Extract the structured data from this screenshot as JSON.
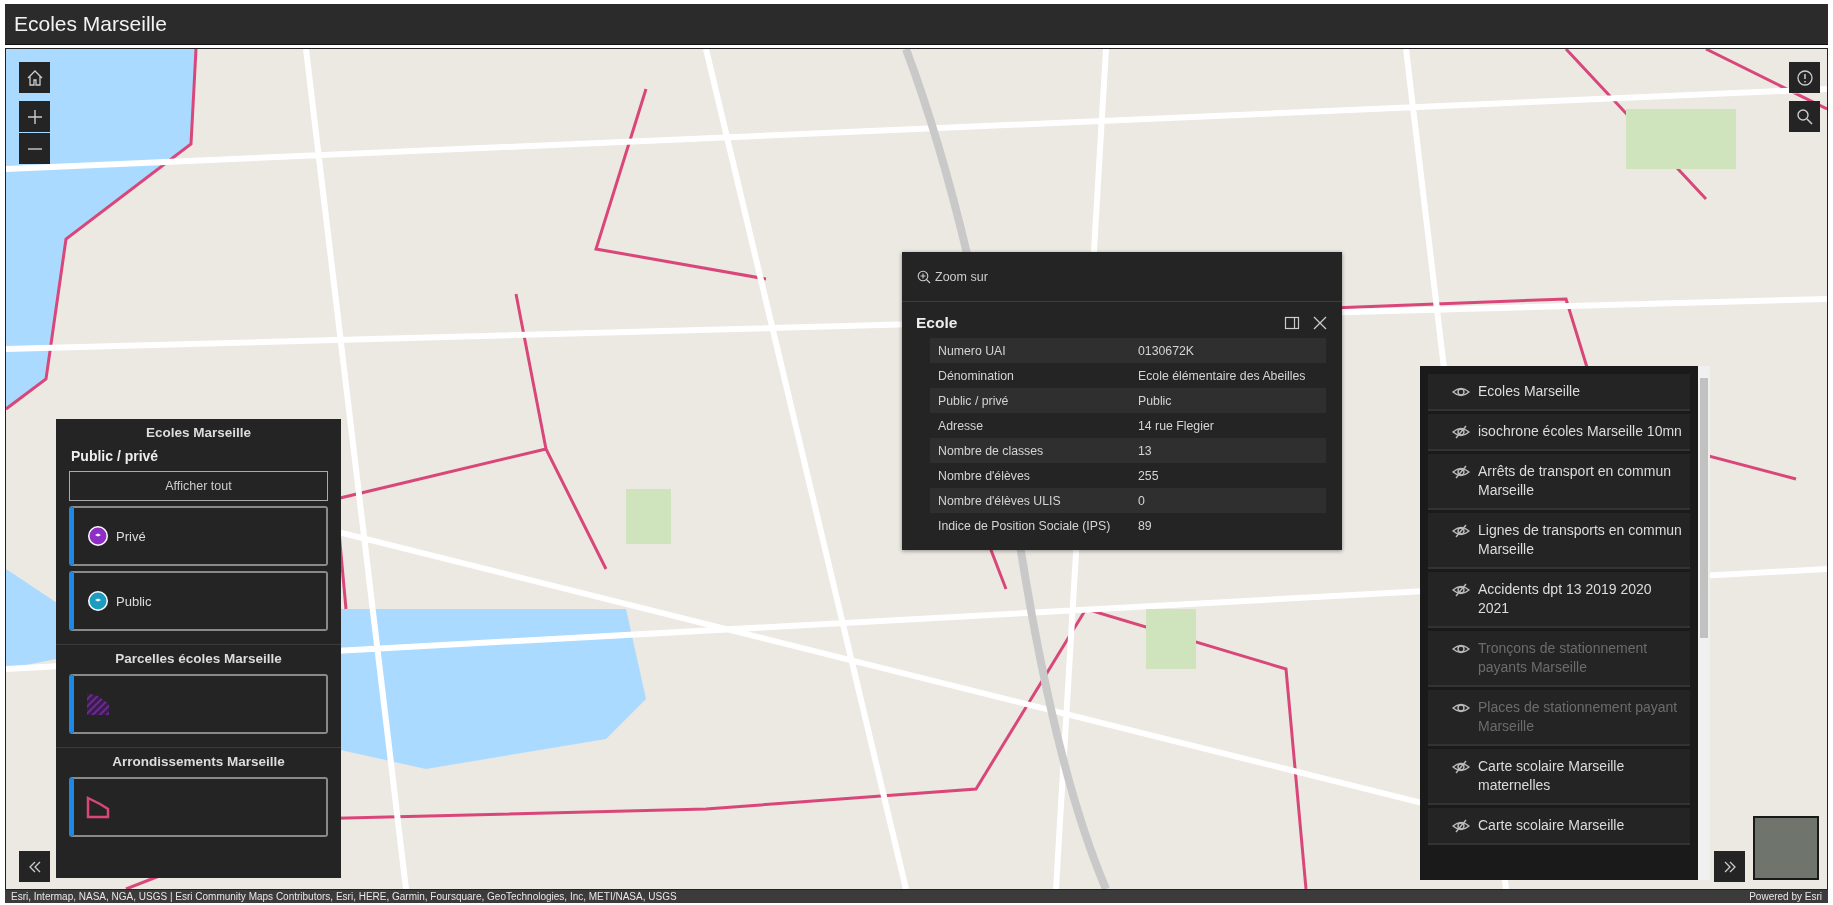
{
  "app": {
    "title": "Ecoles Marseille"
  },
  "legend": {
    "layers": [
      {
        "title": "Ecoles Marseille",
        "field": "Public / privé",
        "show_all": "Afficher tout",
        "items": [
          {
            "kind": "school",
            "label": "Privé",
            "color": "#8e2ec4"
          },
          {
            "kind": "school",
            "label": "Public",
            "color": "#1c9cbf"
          }
        ]
      },
      {
        "title": "Parcelles écoles Marseille",
        "items": [
          {
            "kind": "hatch"
          }
        ]
      },
      {
        "title": "Arrondissements Marseille",
        "items": [
          {
            "kind": "outline"
          }
        ]
      }
    ]
  },
  "popup": {
    "action": "Zoom sur",
    "title": "Ecole",
    "fields": [
      {
        "label": "Numero UAI",
        "value": "0130672K"
      },
      {
        "label": "Dénomination",
        "value": "Ecole élémentaire des Abeilles"
      },
      {
        "label": "Public / privé",
        "value": "Public"
      },
      {
        "label": "Adresse",
        "value": "14 rue Flegier"
      },
      {
        "label": "Nombre de classes",
        "value": "13"
      },
      {
        "label": "Nombre d'élèves",
        "value": "255"
      },
      {
        "label": "Nombre d'élèves ULIS",
        "value": "0"
      },
      {
        "label": "Indice de Position Sociale (IPS)",
        "value": "89"
      }
    ]
  },
  "layer_list": {
    "layers": [
      {
        "title": "Ecoles Marseille",
        "visible": true,
        "disabled": false
      },
      {
        "title": "isochrone écoles Marseille 10mn",
        "visible": false,
        "disabled": false
      },
      {
        "title": "Arrêts de transport en commun Marseille",
        "visible": false,
        "disabled": false
      },
      {
        "title": "Lignes de transports en commun Marseille",
        "visible": false,
        "disabled": false
      },
      {
        "title": "Accidents dpt 13 2019 2020 2021",
        "visible": false,
        "disabled": false
      },
      {
        "title": "Tronçons de stationnement payants Marseille",
        "visible": true,
        "disabled": true
      },
      {
        "title": "Places de stationnement payant Marseille",
        "visible": true,
        "disabled": true
      },
      {
        "title": "Carte scolaire Marseille maternelles",
        "visible": false,
        "disabled": false
      },
      {
        "title": "Carte scolaire Marseille",
        "visible": false,
        "disabled": false
      }
    ]
  },
  "attribution": {
    "text": "Esri, Intermap, NASA, NGA, USGS | Esri Community Maps Contributors, Esri, HERE, Garmin, Foursquare, GeoTechnologies, Inc, METI/NASA, USGS",
    "powered_by": "Powered by Esri"
  }
}
